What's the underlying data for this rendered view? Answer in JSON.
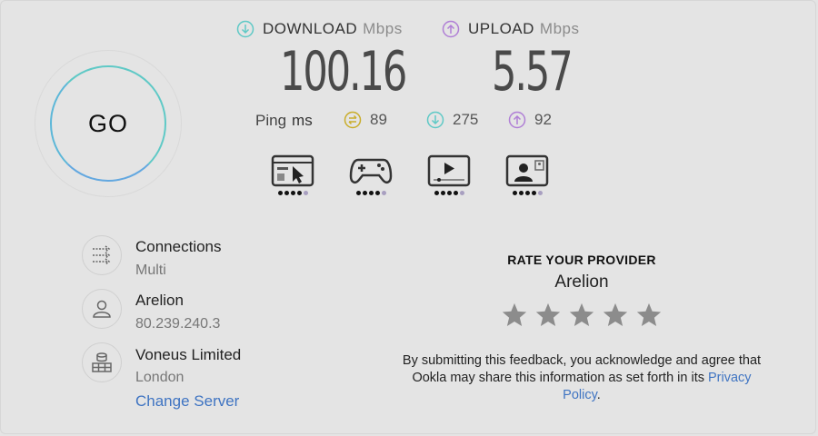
{
  "go": {
    "label": "GO"
  },
  "download": {
    "label": "DOWNLOAD",
    "unit": "Mbps",
    "value": "100.16",
    "color": "#5fc9c6"
  },
  "upload": {
    "label": "UPLOAD",
    "unit": "Mbps",
    "value": "5.57",
    "color": "#b07fd6"
  },
  "ping": {
    "label": "Ping",
    "unit": "ms",
    "idle": {
      "value": "89",
      "color": "#c9ad2a",
      "icon": "ping-idle-icon"
    },
    "download": {
      "value": "275",
      "color": "#5fc9c6",
      "icon": "download-arrow-icon"
    },
    "upload": {
      "value": "92",
      "color": "#b07fd6",
      "icon": "upload-arrow-icon"
    }
  },
  "quality": [
    {
      "name": "web-browsing",
      "icon": "browser-cursor-icon",
      "filled": 4,
      "total": 5
    },
    {
      "name": "gaming",
      "icon": "gamepad-icon",
      "filled": 4,
      "total": 5
    },
    {
      "name": "video-streaming",
      "icon": "video-player-icon",
      "filled": 4,
      "total": 5
    },
    {
      "name": "video-chat",
      "icon": "video-chat-icon",
      "filled": 4,
      "total": 5
    }
  ],
  "connections": {
    "title": "Connections",
    "value": "Multi"
  },
  "isp": {
    "name": "Arelion",
    "ip": "80.239.240.3"
  },
  "server": {
    "name": "Voneus Limited",
    "location": "London",
    "change_label": "Change Server"
  },
  "rate": {
    "title": "RATE YOUR PROVIDER",
    "provider": "Arelion",
    "stars": 5,
    "disclaimer_before": "By submitting this feedback, you acknowledge and agree that Ookla may share this information as set forth in its ",
    "policy_link": "Privacy Policy",
    "disclaimer_after": "."
  }
}
